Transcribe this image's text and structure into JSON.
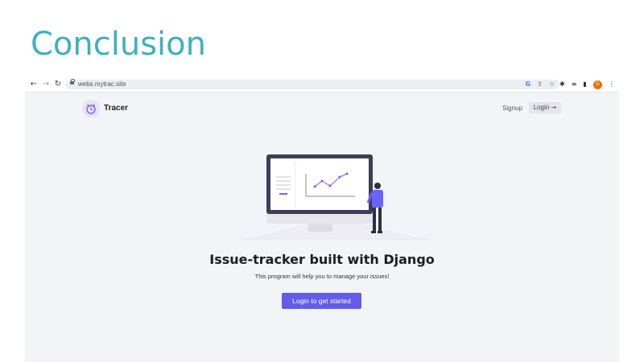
{
  "slide": {
    "title": "Conclusion"
  },
  "browser": {
    "url": "webs.mytrac.site",
    "profile_initial": "G",
    "icons": [
      "back-arrow-icon",
      "forward-arrow-icon",
      "reload-icon",
      "lock-icon",
      "google-icon",
      "share-icon",
      "star-icon",
      "extensions-icon",
      "reading-list-icon",
      "side-panel-icon",
      "profile-avatar",
      "more-menu-icon"
    ]
  },
  "site": {
    "brand": "Tracer",
    "nav": {
      "signup": "Signup",
      "login": "Login"
    },
    "hero": {
      "headline": "Issue-tracker built with Django",
      "subtext": "This program will help you to manage your issues!",
      "cta": "Login to get started"
    },
    "colors": {
      "accent": "#635bea",
      "background": "#f3f4f8",
      "title": "#3fb0c0"
    }
  }
}
